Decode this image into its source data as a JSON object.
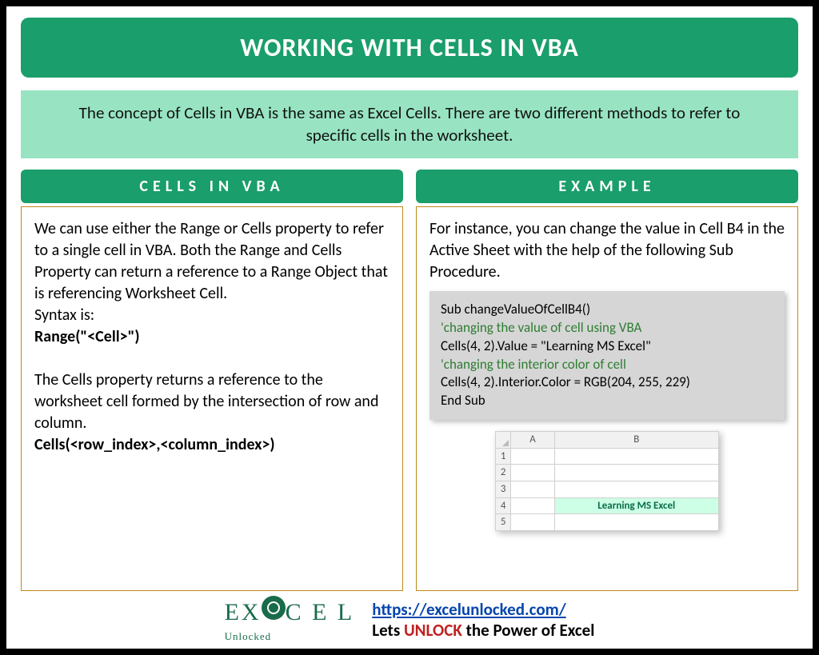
{
  "title": "WORKING WITH CELLS IN VBA",
  "intro": "The concept of Cells in VBA is the same as Excel Cells. There are two different methods to refer to specific cells in the worksheet.",
  "left": {
    "header": "CELLS IN VBA",
    "para1": "We can use either the Range or Cells property to refer to a single cell in VBA. Both the Range and Cells Property can return a reference to a Range Object that is referencing Worksheet Cell.",
    "syntax_label": "Syntax is:",
    "range_syntax": "Range(\"<Cell>\")",
    "para2": "The Cells property returns a reference to the worksheet cell formed by the intersection of row and column.",
    "cells_syntax": "Cells(<row_index>,<column_index>)"
  },
  "right": {
    "header": "EXAMPLE",
    "para": "For instance, you can change the value in Cell B4 in the Active Sheet with the help of the following Sub Procedure.",
    "code": {
      "l1": "Sub changeValueOfCellB4()",
      "l2": "'changing the value of cell using VBA",
      "l3": "Cells(4, 2).Value = \"Learning MS Excel\"",
      "l4": "'changing the interior color of cell",
      "l5": "Cells(4, 2).Interior.Color = RGB(204, 255, 229)",
      "l6": "End Sub"
    },
    "sheet": {
      "colA": "A",
      "colB": "B",
      "rows": [
        "1",
        "2",
        "3",
        "4",
        "5"
      ],
      "b4": "Learning MS Excel"
    }
  },
  "footer": {
    "logo_l1": "EXCEL",
    "logo_l2": "Unlocked",
    "link": "https://excelunlocked.com/",
    "tag_pre": "Lets ",
    "tag_unlock": "UNLOCK",
    "tag_post": " the Power of Excel"
  }
}
